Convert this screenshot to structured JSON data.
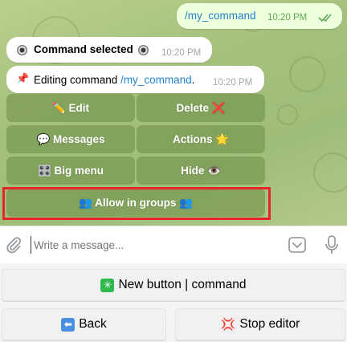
{
  "chat": {
    "outgoing": {
      "text": "/my_command",
      "time": "10:20 PM"
    },
    "msg1": {
      "text": "Command selected",
      "time": "10:20 PM"
    },
    "msg2": {
      "prefix": "Editing command ",
      "link": "/my_command",
      "suffix": ".",
      "time": "10:20 PM"
    }
  },
  "inline_keyboard": {
    "edit": "✏️ Edit",
    "delete": "Delete ❌",
    "messages": "💬 Messages",
    "actions": "Actions 🌟",
    "big_menu": "🎛️ Big menu",
    "hide": "Hide 👁️",
    "allow_groups": "👥 Allow in groups 👥"
  },
  "composer": {
    "placeholder": "Write a message..."
  },
  "reply_keyboard": {
    "new_button": "New button | command",
    "back": "Back",
    "stop_editor": "Stop editor"
  },
  "icons": {
    "attach": "paperclip-icon",
    "bot_menu": "bot-command-icon",
    "mic": "microphone-icon",
    "read_receipt": "double-check-icon"
  },
  "colors": {
    "highlight_border": "#e2262c",
    "link": "#2481cc",
    "new_button_emoji": "#2fb84c",
    "back_emoji": "#4a90e2",
    "stop_emoji": "#d83a2a"
  }
}
